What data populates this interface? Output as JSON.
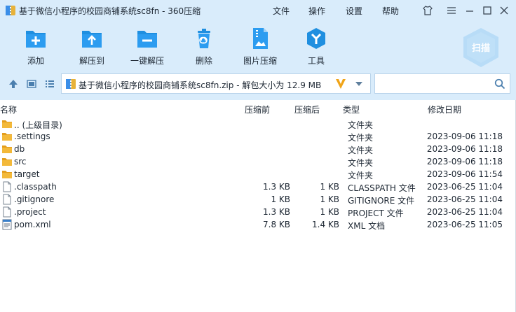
{
  "window": {
    "title": "基于微信小程序的校园商铺系统sc8fn - 360压缩",
    "menu": [
      "文件",
      "操作",
      "设置",
      "帮助"
    ],
    "controls": [
      "skin-icon",
      "menu-icon",
      "minimize-icon",
      "maximize-icon",
      "close-icon"
    ]
  },
  "toolbar": {
    "buttons": [
      {
        "label": "添加",
        "icon": "add-icon"
      },
      {
        "label": "解压到",
        "icon": "extract-to-icon"
      },
      {
        "label": "一键解压",
        "icon": "one-click-extract-icon"
      },
      {
        "label": "删除",
        "icon": "delete-icon"
      },
      {
        "label": "图片压缩",
        "icon": "image-compress-icon"
      },
      {
        "label": "工具",
        "icon": "tools-icon"
      }
    ],
    "scan_label": "扫描"
  },
  "pathbar": {
    "path": "基于微信小程序的校园商铺系统sc8fn.zip - 解包大小为 12.9 MB",
    "search_placeholder": ""
  },
  "columns": {
    "name": "名称",
    "packed": "压缩前",
    "size": "压缩后",
    "type": "类型",
    "modified": "修改日期"
  },
  "files": [
    {
      "name": ".. (上级目录)",
      "packed": "",
      "size": "",
      "type": "文件夹",
      "modified": "",
      "kind": "folder"
    },
    {
      "name": ".settings",
      "packed": "",
      "size": "",
      "type": "文件夹",
      "modified": "2023-09-06 11:18",
      "kind": "folder"
    },
    {
      "name": "db",
      "packed": "",
      "size": "",
      "type": "文件夹",
      "modified": "2023-09-06 11:18",
      "kind": "folder"
    },
    {
      "name": "src",
      "packed": "",
      "size": "",
      "type": "文件夹",
      "modified": "2023-09-06 11:18",
      "kind": "folder"
    },
    {
      "name": "target",
      "packed": "",
      "size": "",
      "type": "文件夹",
      "modified": "2023-09-06 11:54",
      "kind": "folder"
    },
    {
      "name": ".classpath",
      "packed": "1.3 KB",
      "size": "1 KB",
      "type": "CLASSPATH 文件",
      "modified": "2023-06-25 11:04",
      "kind": "file"
    },
    {
      "name": ".gitignore",
      "packed": "1 KB",
      "size": "1 KB",
      "type": "GITIGNORE 文件",
      "modified": "2023-06-25 11:04",
      "kind": "file"
    },
    {
      "name": ".project",
      "packed": "1.3 KB",
      "size": "1 KB",
      "type": "PROJECT 文件",
      "modified": "2023-06-25 11:04",
      "kind": "file"
    },
    {
      "name": "pom.xml",
      "packed": "7.8 KB",
      "size": "1.4 KB",
      "type": "XML 文档",
      "modified": "2023-06-25 11:05",
      "kind": "xml"
    }
  ],
  "colors": {
    "chrome": "#d9ecfb",
    "accent": "#1f8fe0",
    "folder": "#f3b93a"
  }
}
